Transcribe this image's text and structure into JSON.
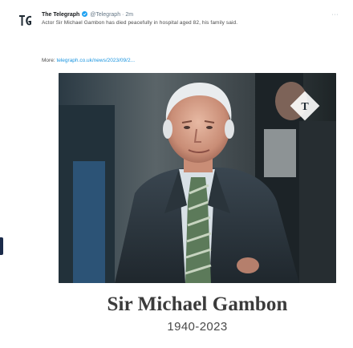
{
  "tweet": {
    "author_name": "The Telegraph",
    "handle": "@Telegraph",
    "separator": "·",
    "time": "2m",
    "menu_glyph": "···",
    "body": "Actor Sir Michael Gambon has died peacefully in hospital aged 82, his family said.",
    "more_label": "More:",
    "link": "telegraph.co.uk/news/2023/09/2..."
  },
  "card": {
    "name": "Sir Michael Gambon",
    "years": "1940-2023"
  },
  "icons": {
    "avatar": "telegraph-logo-icon",
    "verified": "verified-badge-icon",
    "watermark": "telegraph-watermark-icon"
  },
  "colors": {
    "link": "#1b95e0",
    "verified": "#1da1f2",
    "muted": "#657786"
  }
}
